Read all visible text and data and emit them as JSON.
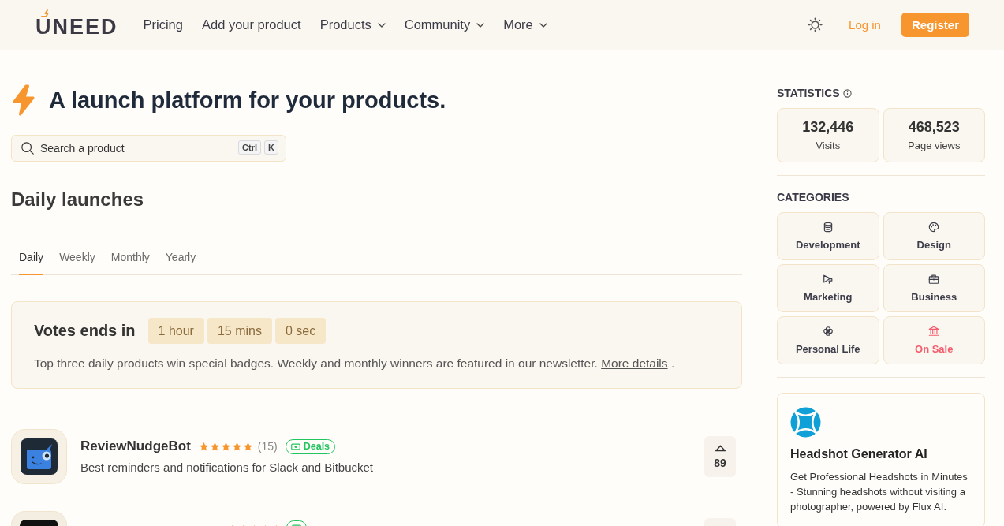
{
  "header": {
    "logo": "UNEED",
    "nav": [
      {
        "label": "Pricing",
        "dropdown": false
      },
      {
        "label": "Add your product",
        "dropdown": false
      },
      {
        "label": "Products",
        "dropdown": true
      },
      {
        "label": "Community",
        "dropdown": true
      },
      {
        "label": "More",
        "dropdown": true
      }
    ],
    "login": "Log in",
    "register": "Register"
  },
  "hero": {
    "title": "A launch platform for your products.",
    "search": {
      "placeholder": "Search a product",
      "shortcut": [
        "Ctrl",
        "K"
      ]
    }
  },
  "launches": {
    "heading": "Daily launches",
    "tabs": [
      {
        "label": "Daily",
        "selected": true
      },
      {
        "label": "Weekly",
        "selected": false
      },
      {
        "label": "Monthly",
        "selected": false
      },
      {
        "label": "Yearly",
        "selected": false
      }
    ],
    "votes": {
      "title": "Votes ends in",
      "countdown": [
        "1 hour",
        "15 mins",
        "0 sec"
      ],
      "text": "Top three daily products win special badges. Weekly and monthly winners are featured in our newsletter.",
      "link": "More details",
      "after_link": "."
    },
    "products": [
      {
        "name": "ReviewNudgeBot",
        "stars": 5,
        "reviews": "(15)",
        "deal": true,
        "badge": "Deals",
        "description": "Best reminders and notifications for Slack and Bitbucket",
        "votes": "89"
      },
      {
        "stars": 5,
        "deal": true
      }
    ]
  },
  "sidebar": {
    "statistics": {
      "title": "STATISTICS",
      "items": [
        {
          "value": "132,446",
          "label": "Visits"
        },
        {
          "value": "468,523",
          "label": "Page views"
        }
      ]
    },
    "categories": {
      "title": "CATEGORIES",
      "items": [
        {
          "label": "Development",
          "color": "#3d3d4a"
        },
        {
          "label": "Design",
          "color": "#3d3d4a"
        },
        {
          "label": "Marketing",
          "color": "#3d3d4a"
        },
        {
          "label": "Business",
          "color": "#3d3d4a"
        },
        {
          "label": "Personal Life",
          "color": "#3d3d4a"
        },
        {
          "label": "On Sale",
          "color": "#f45c6c"
        }
      ]
    },
    "ad": {
      "title": "Headshot Generator AI",
      "description": "Get Professional Headshots in Minutes - Stunning headshots without visiting a photographer, powered by Flux AI."
    }
  }
}
